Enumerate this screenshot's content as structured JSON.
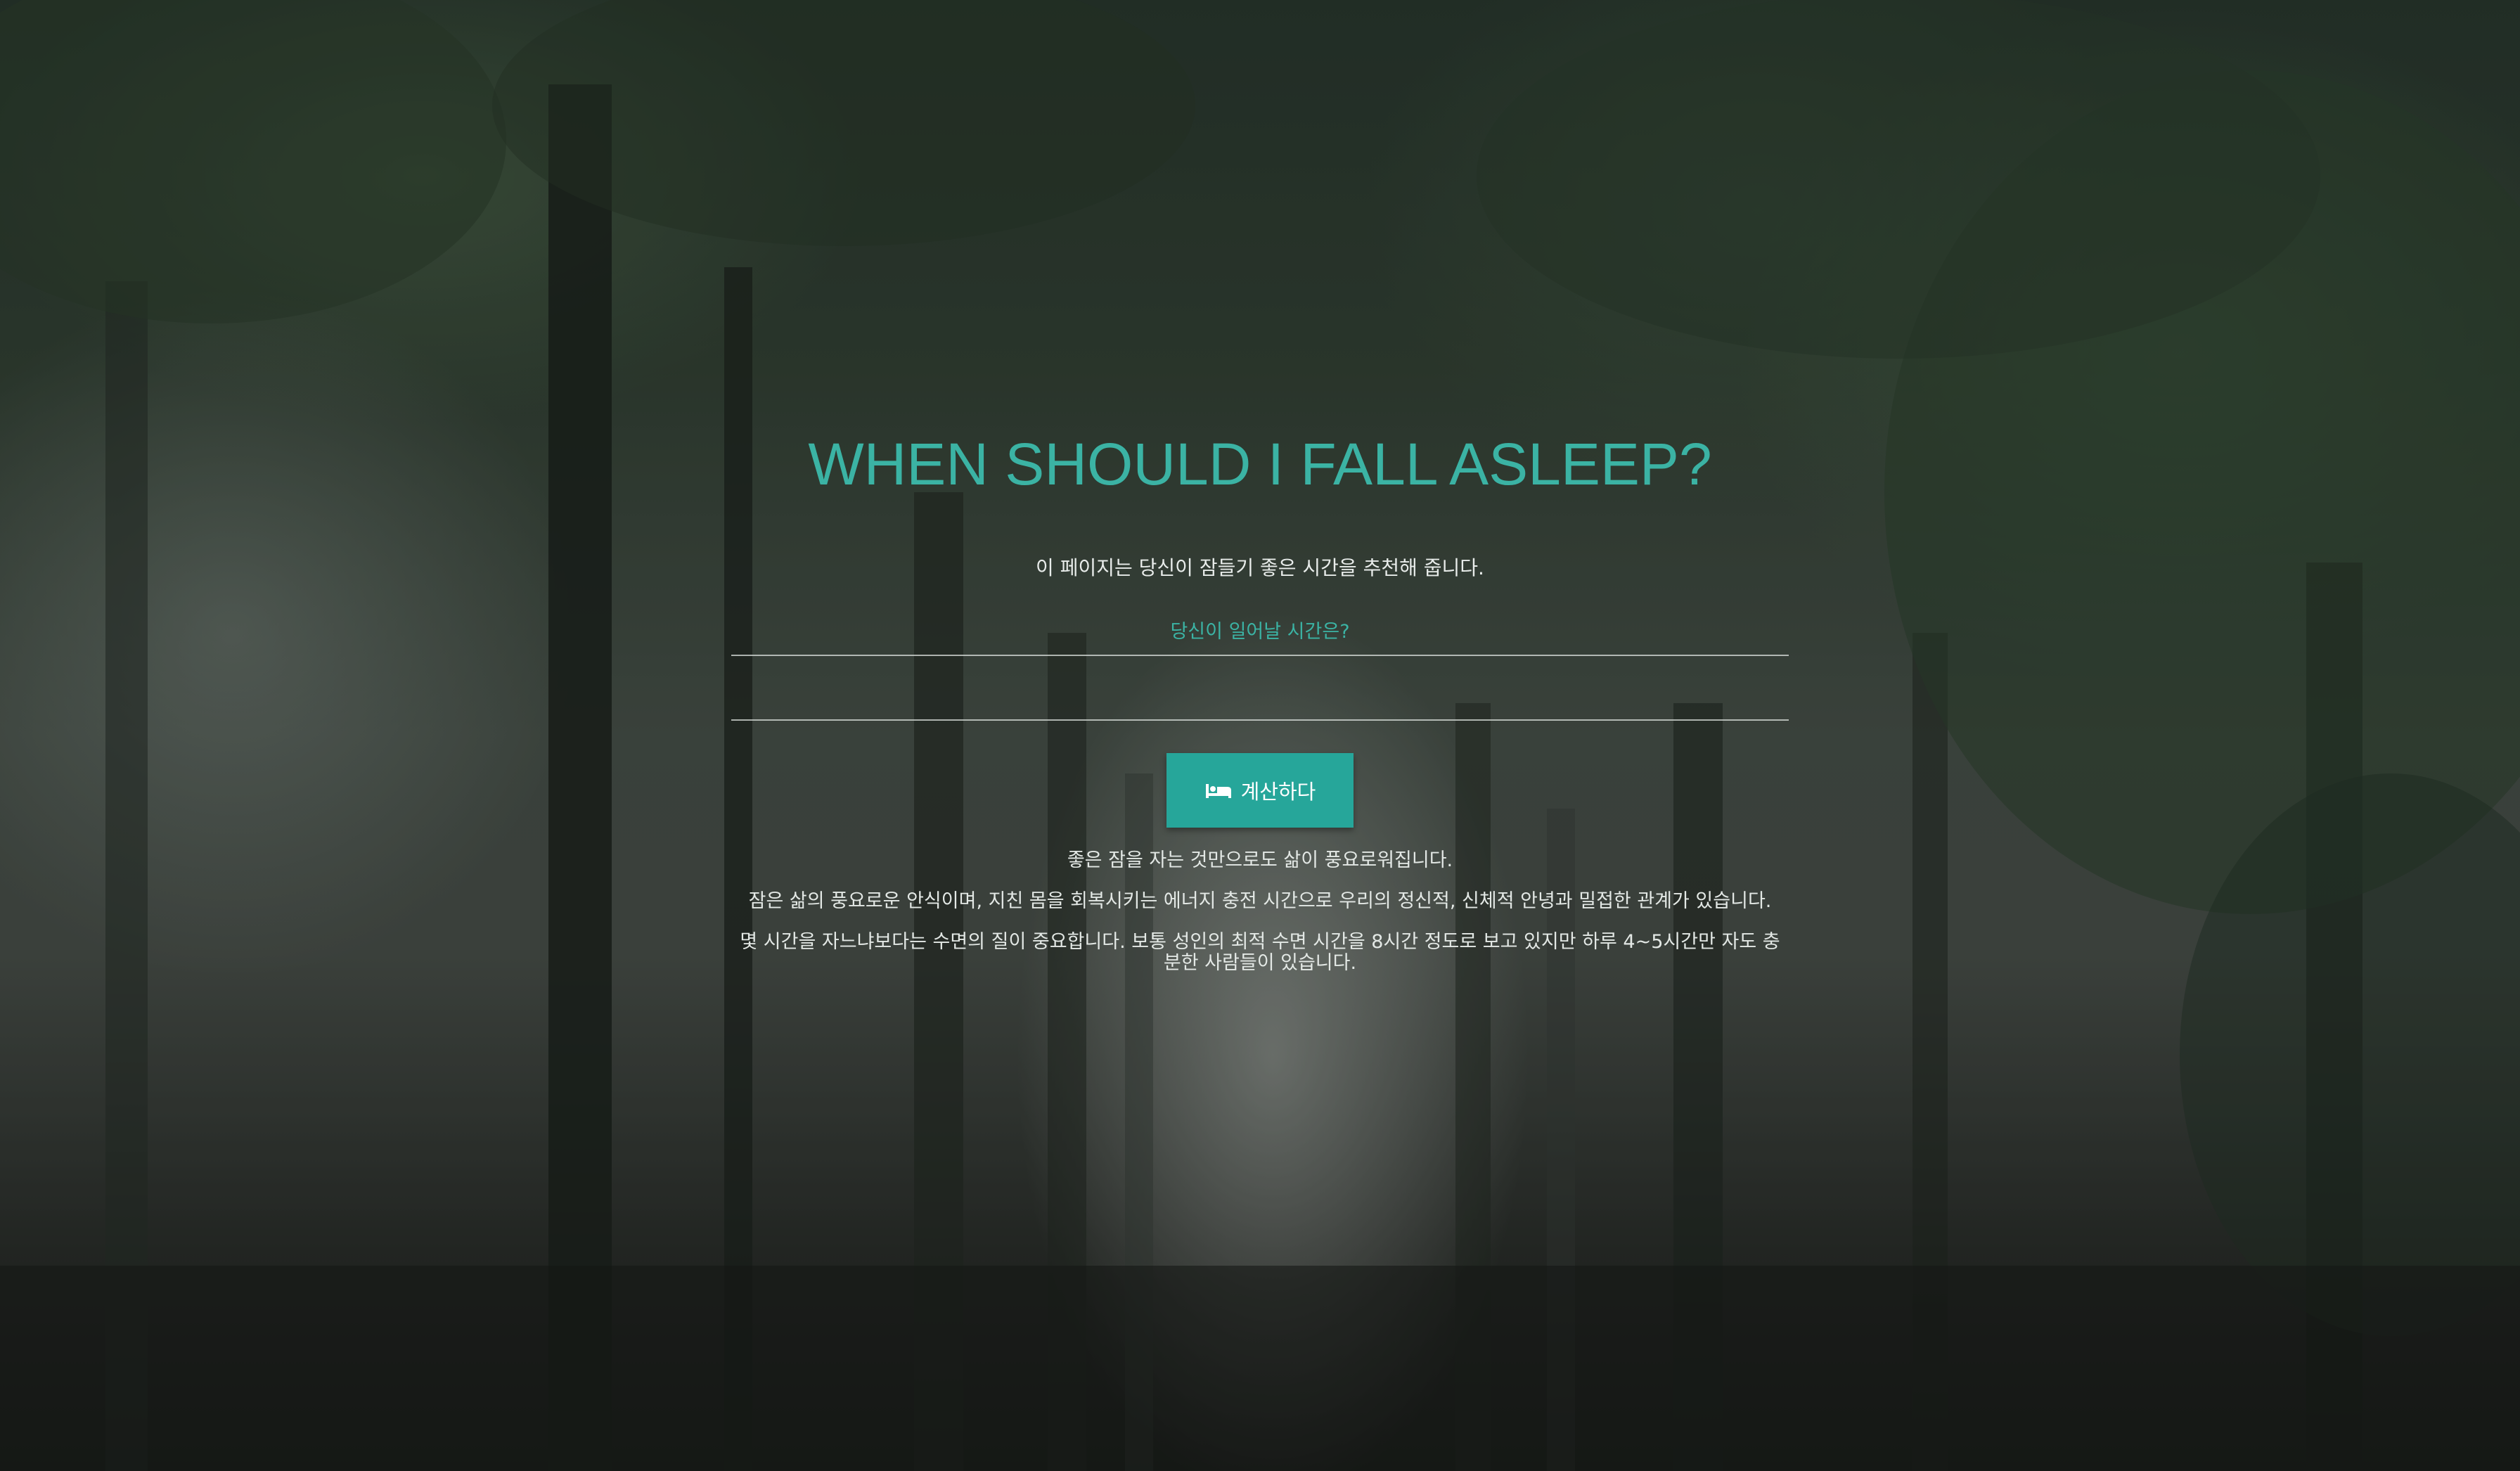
{
  "page": {
    "title": "WHEN SHOULD I FALL ASLEEP?",
    "intro": "이 페이지는 당신이 잠들기 좋은 시간을 추천해 줍니다.",
    "wake_label": "당신이 일어날 시간은?",
    "wake_value": "",
    "calculate_label": "계산하다",
    "calculate_icon": "bed-icon",
    "paragraph_1": "좋은 잠을 자는 것만으로도 삶이 풍요로워집니다.",
    "paragraph_2": "잠은 삶의 풍요로운 안식이며, 지친 몸을 회복시키는 에너지 충전 시간으로 우리의 정신적, 신체적 안녕과 밀접한 관계가 있습니다.",
    "paragraph_3": "몇 시간을 자느냐보다는 수면의 질이 중요합니다. 보통 성인의 최적 수면 시간을 8시간 정도로 보고 있지만 하루 4~5시간만 자도 충분한 사람들이 있습니다."
  },
  "colors": {
    "accent": "#3bb3a4",
    "button": "#26a69a",
    "text": "#e8ecea"
  }
}
